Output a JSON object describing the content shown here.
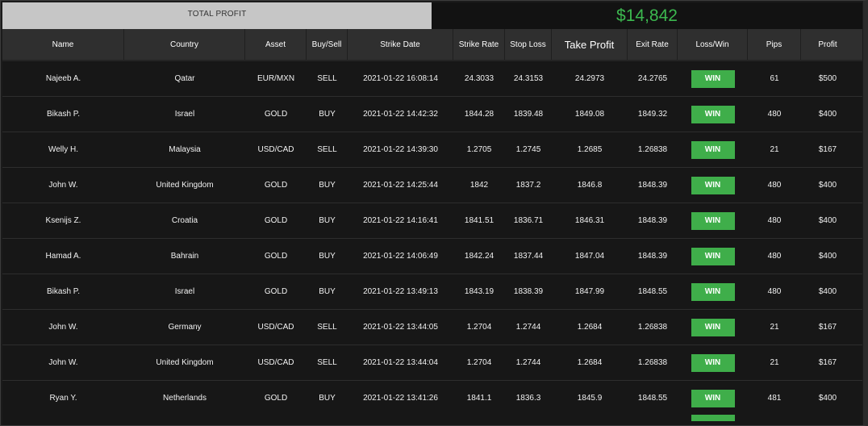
{
  "summary": {
    "total_profit_label": "TOTAL PROFIT",
    "total_profit_value": "$14,842"
  },
  "columns": {
    "name": "Name",
    "country": "Country",
    "asset": "Asset",
    "buy_sell": "Buy/Sell",
    "strike_date": "Strike Date",
    "strike_rate": "Strike Rate",
    "stop_loss": "Stop Loss",
    "take_profit": "Take Profit",
    "exit_rate": "Exit Rate",
    "loss_win": "Loss/Win",
    "pips": "Pips",
    "profit": "Profit"
  },
  "rows": [
    {
      "name": "Najeeb A.",
      "country": "Qatar",
      "asset": "EUR/MXN",
      "buy_sell": "SELL",
      "strike_date": "2021-01-22 16:08:14",
      "strike_rate": "24.3033",
      "stop_loss": "24.3153",
      "take_profit": "24.2973",
      "exit_rate": "24.2765",
      "loss_win": "WIN",
      "pips": "61",
      "profit": "$500"
    },
    {
      "name": "Bikash P.",
      "country": "Israel",
      "asset": "GOLD",
      "buy_sell": "BUY",
      "strike_date": "2021-01-22 14:42:32",
      "strike_rate": "1844.28",
      "stop_loss": "1839.48",
      "take_profit": "1849.08",
      "exit_rate": "1849.32",
      "loss_win": "WIN",
      "pips": "480",
      "profit": "$400"
    },
    {
      "name": "Welly H.",
      "country": "Malaysia",
      "asset": "USD/CAD",
      "buy_sell": "SELL",
      "strike_date": "2021-01-22 14:39:30",
      "strike_rate": "1.2705",
      "stop_loss": "1.2745",
      "take_profit": "1.2685",
      "exit_rate": "1.26838",
      "loss_win": "WIN",
      "pips": "21",
      "profit": "$167"
    },
    {
      "name": "John W.",
      "country": "United Kingdom",
      "asset": "GOLD",
      "buy_sell": "BUY",
      "strike_date": "2021-01-22 14:25:44",
      "strike_rate": "1842",
      "stop_loss": "1837.2",
      "take_profit": "1846.8",
      "exit_rate": "1848.39",
      "loss_win": "WIN",
      "pips": "480",
      "profit": "$400"
    },
    {
      "name": "Ksenijs Z.",
      "country": "Croatia",
      "asset": "GOLD",
      "buy_sell": "BUY",
      "strike_date": "2021-01-22 14:16:41",
      "strike_rate": "1841.51",
      "stop_loss": "1836.71",
      "take_profit": "1846.31",
      "exit_rate": "1848.39",
      "loss_win": "WIN",
      "pips": "480",
      "profit": "$400"
    },
    {
      "name": "Hamad A.",
      "country": "Bahrain",
      "asset": "GOLD",
      "buy_sell": "BUY",
      "strike_date": "2021-01-22 14:06:49",
      "strike_rate": "1842.24",
      "stop_loss": "1837.44",
      "take_profit": "1847.04",
      "exit_rate": "1848.39",
      "loss_win": "WIN",
      "pips": "480",
      "profit": "$400"
    },
    {
      "name": "Bikash P.",
      "country": "Israel",
      "asset": "GOLD",
      "buy_sell": "BUY",
      "strike_date": "2021-01-22 13:49:13",
      "strike_rate": "1843.19",
      "stop_loss": "1838.39",
      "take_profit": "1847.99",
      "exit_rate": "1848.55",
      "loss_win": "WIN",
      "pips": "480",
      "profit": "$400"
    },
    {
      "name": "John W.",
      "country": "Germany",
      "asset": "USD/CAD",
      "buy_sell": "SELL",
      "strike_date": "2021-01-22 13:44:05",
      "strike_rate": "1.2704",
      "stop_loss": "1.2744",
      "take_profit": "1.2684",
      "exit_rate": "1.26838",
      "loss_win": "WIN",
      "pips": "21",
      "profit": "$167"
    },
    {
      "name": "John W.",
      "country": "United Kingdom",
      "asset": "USD/CAD",
      "buy_sell": "SELL",
      "strike_date": "2021-01-22 13:44:04",
      "strike_rate": "1.2704",
      "stop_loss": "1.2744",
      "take_profit": "1.2684",
      "exit_rate": "1.26838",
      "loss_win": "WIN",
      "pips": "21",
      "profit": "$167"
    },
    {
      "name": "Ryan Y.",
      "country": "Netherlands",
      "asset": "GOLD",
      "buy_sell": "BUY",
      "strike_date": "2021-01-22 13:41:26",
      "strike_rate": "1841.1",
      "stop_loss": "1836.3",
      "take_profit": "1845.9",
      "exit_rate": "1848.55",
      "loss_win": "WIN",
      "pips": "481",
      "profit": "$400"
    }
  ],
  "colors": {
    "accent_green": "#3cb84f",
    "win_badge": "#3fae4a",
    "header_bg": "#2f2f2f",
    "row_bg": "#171717"
  }
}
